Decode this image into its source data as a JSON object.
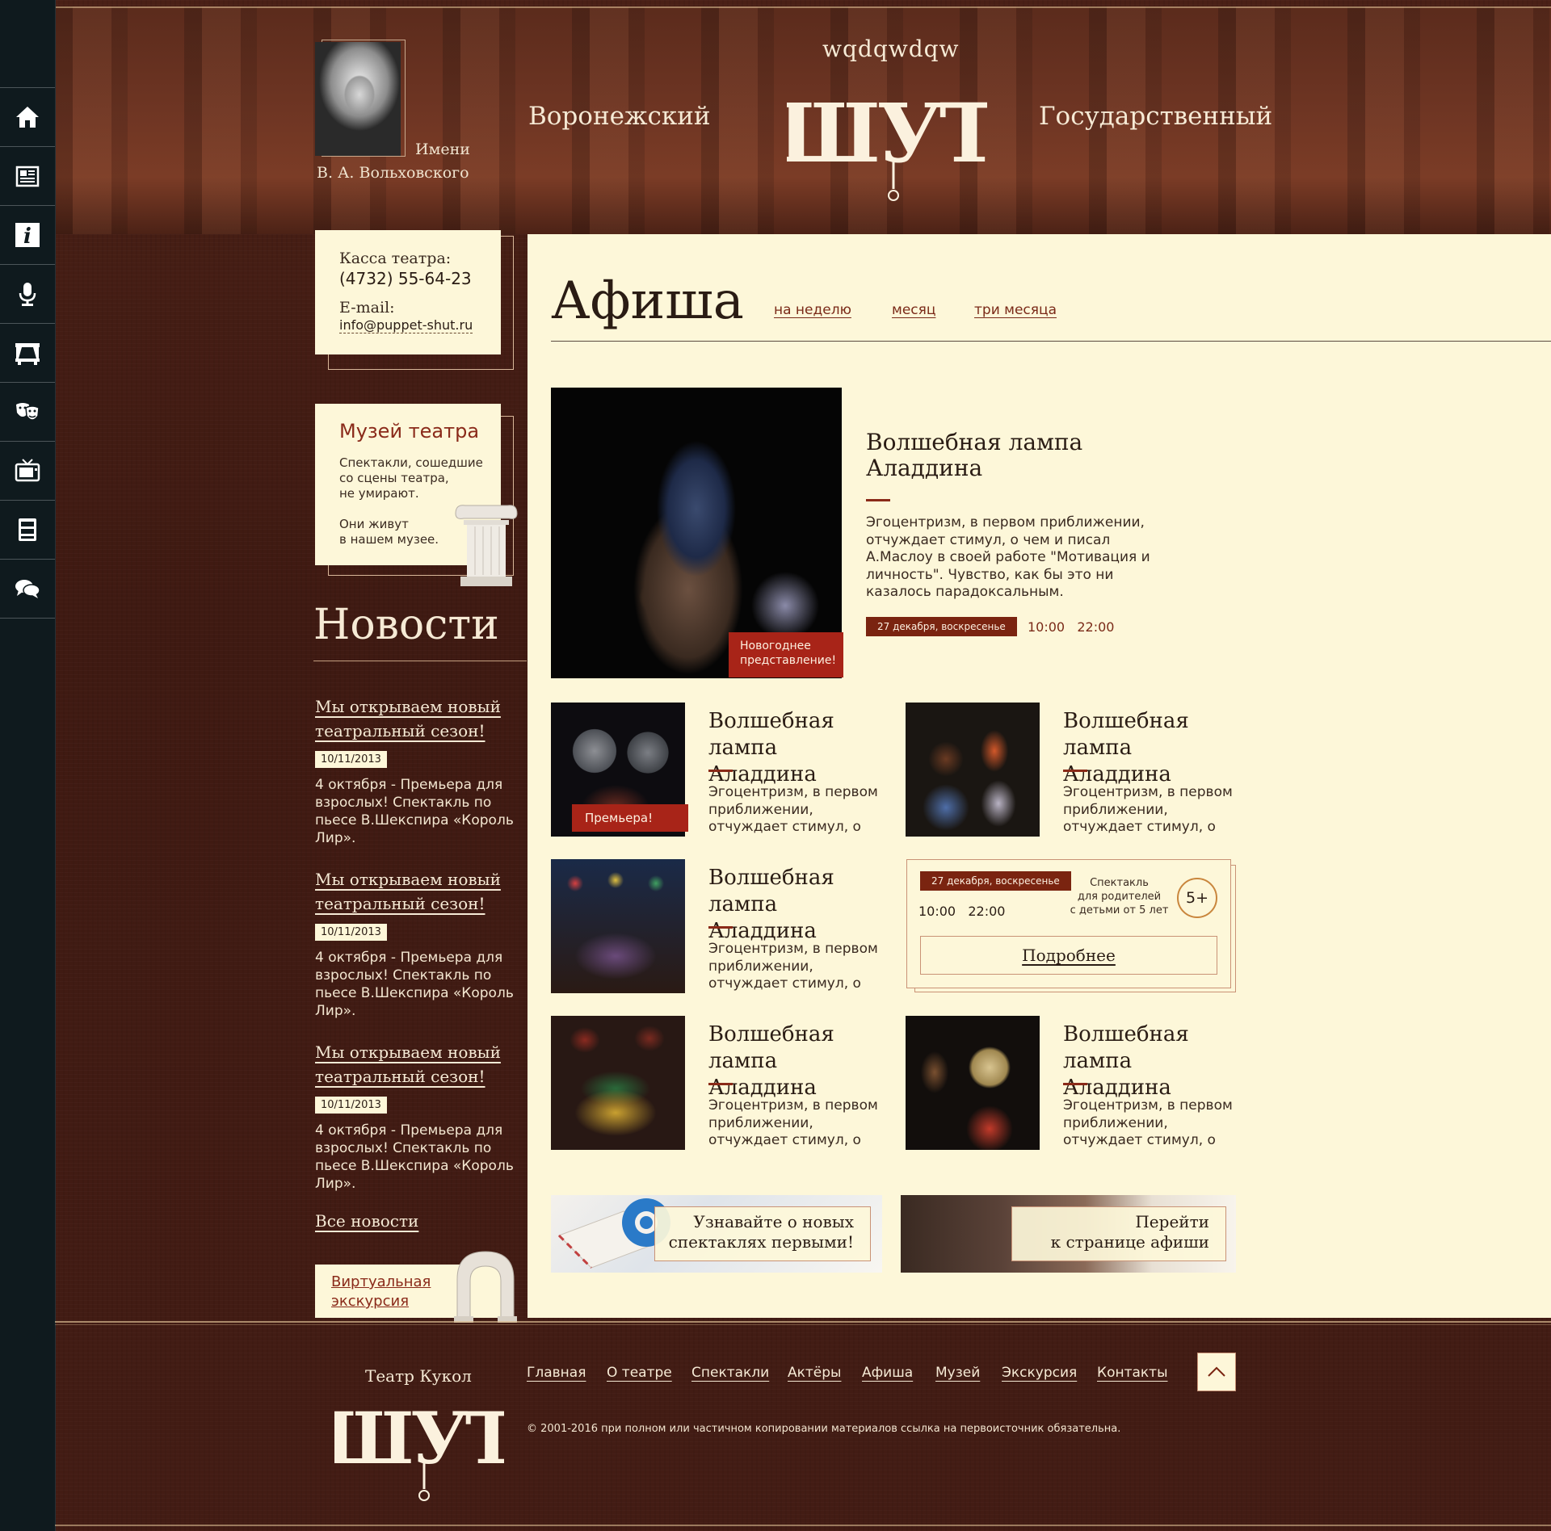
{
  "header": {
    "imeni": "Имени",
    "name": "В. А. Вольховского",
    "top_word": "wqdqwdqw",
    "left_word": "Воронежский",
    "right_word": "Государственный",
    "logo_text": "\"ШУТ\""
  },
  "kassa": {
    "label": "Касса театра:",
    "phone": "(4732) 55-64-23",
    "email_label": "E-mail:",
    "email": "info@puppet-shut.ru"
  },
  "museum": {
    "title": "Музей театра",
    "text1": "Спектакли, сошедшие\nсо сцены театра,\nне умирают.",
    "text2": "Они живут\nв нашем музее."
  },
  "news": {
    "title": "Новости",
    "items": [
      {
        "title": "Мы открываем новый театральный сезон!",
        "date": "10/11/2013",
        "text": "4 октября - Премьера для взрослых! Спектакль по пьесе В.Шекспира «Король Лир»."
      },
      {
        "title": "Мы открываем новый театральный сезон!",
        "date": "10/11/2013",
        "text": "4 октября - Премьера для взрослых! Спектакль по пьесе В.Шекспира «Король Лир»."
      },
      {
        "title": "Мы открываем новый театральный сезон!",
        "date": "10/11/2013",
        "text": "4 октября - Премьера для взрослых! Спектакль по пьесе В.Шекспира «Король Лир»."
      }
    ],
    "all_link": "Все новости"
  },
  "virtual": {
    "label": "Виртуальная\nэкскурсия"
  },
  "afisha": {
    "title": "Афиша",
    "tabs": [
      "на неделю",
      "месяц",
      "три месяца"
    ],
    "featured": {
      "title": "Волшебная лампа\nАладдина",
      "desc": "Эгоцентризм, в первом приближении, отчуждает стимул, о чем и писал А.Маслоу в своей работе \"Мотивация и личность\". Чувство, как бы это ни казалось парадоксальным.",
      "badge": "Новогоднее\nпредставление!",
      "date": "27 декабря, воскресенье",
      "times": "10:00   22:00"
    },
    "cards": [
      {
        "title": "Волшебная\nлампа Аладдина",
        "desc": "Эгоцентризм, в первом приближении, отчуждает стимул, о",
        "badge": "Премьера!"
      },
      {
        "title": "Волшебная\nлампа Аладдина",
        "desc": "Эгоцентризм, в первом приближении, отчуждает стимул, о"
      },
      {
        "title": "Волшебная\nлампа Аладдина",
        "desc": "Эгоцентризм, в первом приближении, отчуждает стимул, о"
      },
      {
        "title": "Волшебная\nлампа Аладдина",
        "desc": "Эгоцентризм, в первом приближении, отчуждает стимул, о"
      },
      {
        "title": "Волшебная\nлампа Аладдина",
        "desc": "Эгоцентризм, в первом приближении, отчуждает стимул, о"
      }
    ],
    "popup": {
      "date": "27 декабря, воскресенье",
      "times": "10:00   22:00",
      "audience": "Спектакль\nдля родителей\nс детьми от 5 лет",
      "age": "5+",
      "more": "Подробнее"
    },
    "banners": {
      "subscribe": "Узнавайте о новых\nспектаклях первыми!",
      "goto": "Перейти\nк странице афиши"
    }
  },
  "footer": {
    "theatre": "Театр Кукол",
    "nav": [
      "Главная",
      "О театре",
      "Спектакли",
      "Актёры",
      "Афиша",
      "Музей",
      "Экскурсия",
      "Контакты"
    ],
    "copyright": "© 2001-2016 при полном или частичном копировании материалов ссылка на первоисточник обязательна."
  },
  "sidebar": {
    "icons": [
      "home-icon",
      "newspaper-icon",
      "info-icon",
      "microphone-icon",
      "stage-icon",
      "theatre-masks-icon",
      "tv-icon",
      "archive-icon",
      "chat-icon"
    ]
  },
  "colors": {
    "accent": "#7a2410",
    "badge": "#a82418",
    "paper": "#fdf7d9",
    "sidebar": "#0f1a1e"
  }
}
